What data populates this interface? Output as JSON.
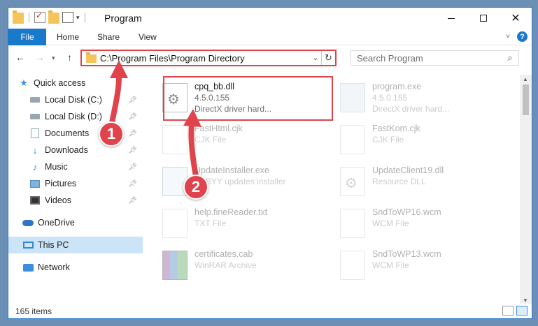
{
  "window": {
    "title": "Program"
  },
  "ribbon": {
    "file": "File",
    "home": "Home",
    "share": "Share",
    "view": "View"
  },
  "address": {
    "path": "C:\\Program Files\\Program Directory",
    "search_placeholder": "Search Program"
  },
  "nav": {
    "items": [
      {
        "label": "Quick access",
        "icon": "star-icon",
        "pinned": false
      },
      {
        "label": "Local Disk (C:)",
        "icon": "drive-icon",
        "pinned": true
      },
      {
        "label": "Local Disk (D:)",
        "icon": "drive-icon",
        "pinned": true
      },
      {
        "label": "Documents",
        "icon": "documents-icon",
        "pinned": true
      },
      {
        "label": "Downloads",
        "icon": "downloads-icon",
        "pinned": true
      },
      {
        "label": "Music",
        "icon": "music-icon",
        "pinned": true
      },
      {
        "label": "Pictures",
        "icon": "pictures-icon",
        "pinned": true
      },
      {
        "label": "Videos",
        "icon": "videos-icon",
        "pinned": true
      },
      {
        "label": "OneDrive",
        "icon": "onedrive-icon",
        "pinned": false
      },
      {
        "label": "This PC",
        "icon": "this-pc-icon",
        "pinned": false,
        "selected": true
      },
      {
        "label": "Network",
        "icon": "network-icon",
        "pinned": false
      }
    ]
  },
  "files": [
    {
      "name": "cpq_bb.dll",
      "line2": "4.5.0.155",
      "line3": "DirectX driver hard...",
      "icon": "dll-icon",
      "highlighted": true
    },
    {
      "name": "program.exe",
      "line2": "4.5.0.155",
      "line3": "DirectX driver hard...",
      "icon": "exe-icon"
    },
    {
      "name": "FastHtml.cjk",
      "line2": "CJK File",
      "line3": "",
      "icon": "doc-icon"
    },
    {
      "name": "FastKom.cjk",
      "line2": "CJK File",
      "line3": "",
      "icon": "doc-icon"
    },
    {
      "name": "UpdateInstaller.exe",
      "line2": "ABBYY updates installer",
      "line3": "",
      "icon": "installer-icon"
    },
    {
      "name": "UpdateClient19.dll",
      "line2": "Resource DLL",
      "line3": "",
      "icon": "dll-icon"
    },
    {
      "name": "help.fineReader.txt",
      "line2": "TXT File",
      "line3": "",
      "icon": "doc-icon"
    },
    {
      "name": "SndToWP16.wcm",
      "line2": "WCM File",
      "line3": "",
      "icon": "doc-icon"
    },
    {
      "name": "certificates.cab",
      "line2": "WinRAR Archive",
      "line3": "",
      "icon": "cab-icon"
    },
    {
      "name": "SndToWP13.wcm",
      "line2": "WCM File",
      "line3": "",
      "icon": "doc-icon"
    }
  ],
  "status": {
    "count": "165 items"
  },
  "annotations": {
    "step1": "1",
    "step2": "2"
  },
  "colors": {
    "accent": "#1979ca",
    "highlight": "#e2434b",
    "selected_nav": "#cce4f7"
  }
}
